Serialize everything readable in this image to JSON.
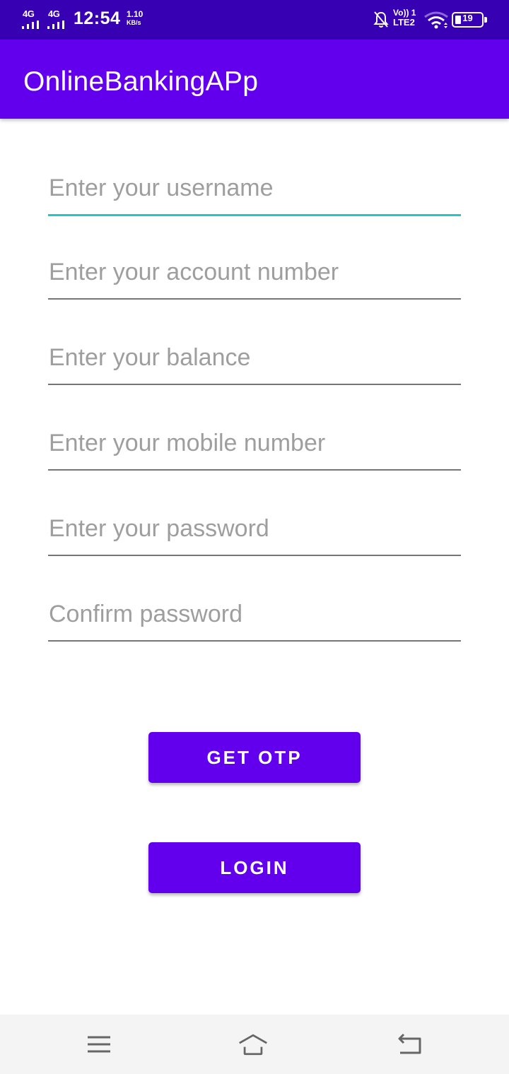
{
  "status_bar": {
    "network_1": "4G",
    "network_2": "4G",
    "time": "12:54",
    "speed_value": "1.10",
    "speed_unit": "KB/s",
    "volte_top": "Vo)) 1",
    "volte_bottom": "LTE2",
    "battery_level": "19",
    "background_color": "#3700B3"
  },
  "app_bar": {
    "title": "OnlineBankingAPp",
    "color": "#6200EE"
  },
  "form": {
    "username_placeholder": "Enter your username",
    "account_placeholder": "Enter your account number",
    "balance_placeholder": "Enter your balance",
    "mobile_placeholder": "Enter your mobile number",
    "password_placeholder": "Enter your password",
    "confirm_placeholder": "Confirm password",
    "focus_color": "#26C6C6"
  },
  "buttons": {
    "get_otp": "GET OTP",
    "login": "LOGIN"
  },
  "nav_bar": {
    "icons": [
      "menu-icon",
      "home-icon",
      "back-icon"
    ]
  }
}
